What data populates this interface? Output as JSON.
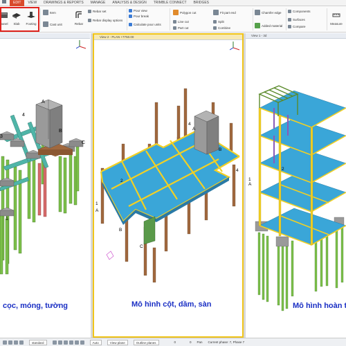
{
  "ribbon_tabs": [
    "EDIT",
    "VIEW",
    "DRAWINGS & REPORTS",
    "MANAGE",
    "ANALYSIS & DESIGN",
    "TRIMBLE CONNECT",
    "BRIDGES"
  ],
  "ribbon": {
    "panel_label": "panel",
    "slab_label": "Slab",
    "footing_label": "Footing",
    "item_label": "Item",
    "cast_unit_label": "Cast unit",
    "rebar_label": "Rebar",
    "rebar_set_label": "Rebar set",
    "rebar_display_label": "Rebar display options",
    "pour_view_label": "Pour view",
    "pour_break_label": "Pour break",
    "calculate_pour_units_label": "Calculate pour units",
    "polygon_cut_label": "Polygon cut",
    "line_cut_label": "Line cut",
    "part_cut_label": "Part cut",
    "fit_part_end_label": "Fit part end",
    "split_label": "Split",
    "combine_label": "Combine",
    "chamfer_edge_label": "Chamfer edge",
    "added_material_label": "Added material",
    "components_label": "Components",
    "surfaces_label": "Surfaces",
    "compare_label": "Compare",
    "measure_label": "Measure"
  },
  "views": {
    "left": {
      "title": "",
      "caption": "cọc, móng, tường"
    },
    "middle": {
      "title": "View 2 - PLAN +7750.00",
      "caption": "Mô hình cột, dầm, sàn"
    },
    "right": {
      "title": "View 1 - 3d",
      "caption": "Mô hình hoàn th"
    }
  },
  "labels": {
    "mid_four": "4",
    "mid_A": "A",
    "mid_B": "B",
    "mid_two": "2",
    "mid_one": "1",
    "mid_C": "C",
    "left_A": "A",
    "left_B": "B",
    "left_C": "C",
    "left_four": "4",
    "left_three": "3",
    "left_one": "1",
    "right_A": "A",
    "right_one": "1",
    "right_two": "2"
  },
  "statusbar": {
    "standard_value": "standard",
    "auto_value": "Auto",
    "view_plane_value": "View plane",
    "outline_planes_value": "Outline planes",
    "count_zero_a": "0",
    "count_zero_b": "0",
    "pan_label": "Pan",
    "current_phase": "Current phase: 7, Phase 7"
  },
  "colors": {
    "accent_tab": "#d94a2b",
    "highlight_box": "#e0231e",
    "active_view_border": "#f0c419",
    "caption_blue": "#1a2fc4",
    "slab_blue": "#3aa6d8",
    "beam_yellow": "#f2d024",
    "column_brown": "#a0683e",
    "pile_green": "#7cc04a",
    "pile_red": "#d66a6a",
    "footing_gray": "#a7a7a7",
    "core_gray": "#8c8c8c"
  }
}
